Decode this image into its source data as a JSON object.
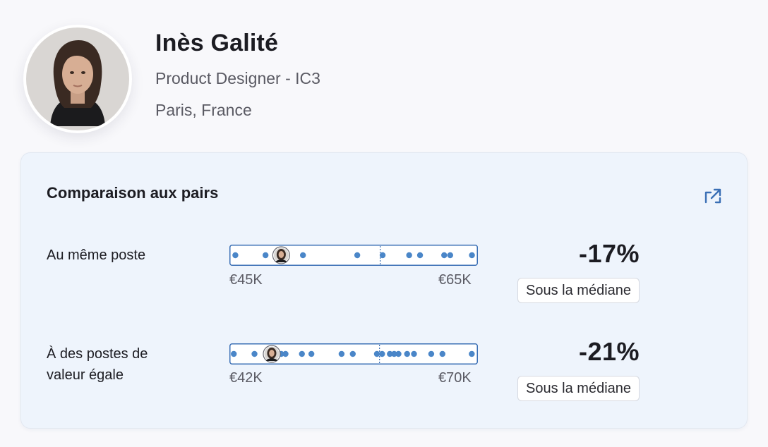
{
  "profile": {
    "name": "Inès Galité",
    "role": "Product Designer - IC3",
    "location": "Paris, France"
  },
  "comparison": {
    "title": "Comparaison aux pairs",
    "accent_color": "#3a6fb5",
    "dot_color": "#4a86c8",
    "rows": [
      {
        "label_lines": [
          "Au même poste"
        ],
        "min_label": "€45K",
        "max_label": "€65K",
        "min": 45,
        "max": 65,
        "peers": [
          45.2,
          47.7,
          50.8,
          55.3,
          57.4,
          59.6,
          60.5,
          62.5,
          63.0,
          64.8
        ],
        "median": 57.2,
        "self": 49.0,
        "delta": "-17%",
        "badge": "Sous la médiane"
      },
      {
        "label_lines": [
          "À des postes de",
          "valeur égale"
        ],
        "min_label": "€42K",
        "max_label": "€70K",
        "min": 42,
        "max": 70,
        "peers": [
          42.1,
          44.5,
          47.6,
          48.1,
          50.0,
          51.1,
          54.6,
          55.9,
          58.7,
          59.3,
          60.2,
          60.7,
          61.2,
          62.2,
          63.0,
          65.0,
          66.3,
          69.7
        ],
        "median": 59.0,
        "self": 46.5,
        "delta": "-21%",
        "badge": "Sous la médiane"
      }
    ]
  }
}
